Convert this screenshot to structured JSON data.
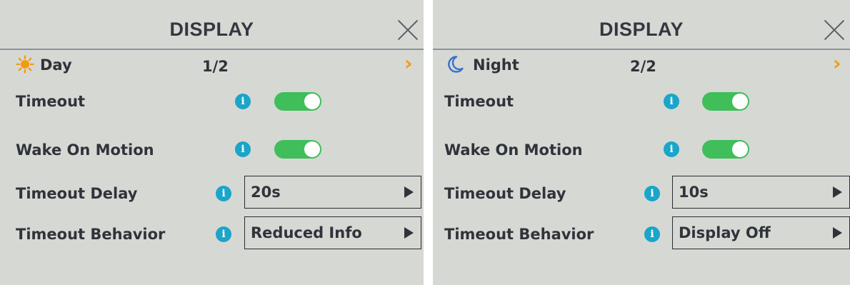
{
  "colors": {
    "panel_background": "#d6d8d4",
    "accent_orange": "#f39a0e",
    "info_blue": "#1aa5c9",
    "toggle_on_green": "#3fbe5a",
    "text_dark": "#2f343a"
  },
  "panels": [
    {
      "title": "DISPLAY",
      "close_icon": "close-icon",
      "mode": {
        "icon": "sun-icon",
        "label": "Day",
        "page": "1/2",
        "next_icon": "chevron-right-icon"
      },
      "timeout": {
        "label": "Timeout",
        "info_icon": "info-icon",
        "info_glyph": "i",
        "enabled": true
      },
      "wake_on_motion": {
        "label": "Wake On Motion",
        "info_icon": "info-icon",
        "info_glyph": "i",
        "enabled": true
      },
      "timeout_delay": {
        "label": "Timeout Delay",
        "info_icon": "info-icon",
        "info_glyph": "i",
        "value": "20s"
      },
      "timeout_behavior": {
        "label": "Timeout Behavior",
        "info_icon": "info-icon",
        "info_glyph": "i",
        "value": "Reduced Info"
      }
    },
    {
      "title": "DISPLAY",
      "close_icon": "close-icon",
      "mode": {
        "icon": "moon-icon",
        "label": "Night",
        "page": "2/2",
        "next_icon": "chevron-right-icon"
      },
      "timeout": {
        "label": "Timeout",
        "info_icon": "info-icon",
        "info_glyph": "i",
        "enabled": true
      },
      "wake_on_motion": {
        "label": "Wake On Motion",
        "info_icon": "info-icon",
        "info_glyph": "i",
        "enabled": true
      },
      "timeout_delay": {
        "label": "Timeout Delay",
        "info_icon": "info-icon",
        "info_glyph": "i",
        "value": "10s"
      },
      "timeout_behavior": {
        "label": "Timeout Behavior",
        "info_icon": "info-icon",
        "info_glyph": "i",
        "value": "Display Off"
      }
    }
  ]
}
